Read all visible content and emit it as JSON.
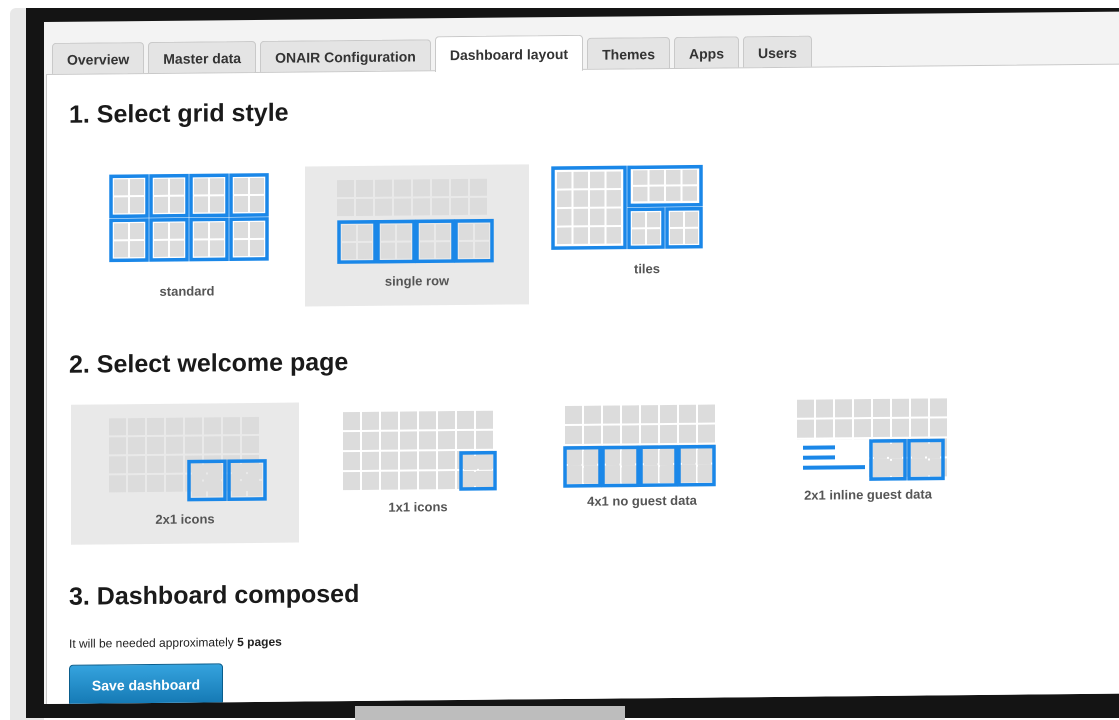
{
  "tabs": [
    {
      "label": "Overview",
      "active": false
    },
    {
      "label": "Master data",
      "active": false
    },
    {
      "label": "ONAIR Configuration",
      "active": false
    },
    {
      "label": "Dashboard layout",
      "active": true
    },
    {
      "label": "Themes",
      "active": false
    },
    {
      "label": "Apps",
      "active": false
    },
    {
      "label": "Users",
      "active": false
    }
  ],
  "section1": {
    "title": "1. Select grid style",
    "options": [
      {
        "label": "standard",
        "selected": false
      },
      {
        "label": "single row",
        "selected": true
      },
      {
        "label": "tiles",
        "selected": false
      }
    ]
  },
  "section2": {
    "title": "2. Select welcome page",
    "options": [
      {
        "label": "2x1 icons",
        "selected": true
      },
      {
        "label": "1x1 icons",
        "selected": false
      },
      {
        "label": "4x1 no guest data",
        "selected": false
      },
      {
        "label": "2x1 inline guest data",
        "selected": false
      }
    ]
  },
  "section3": {
    "title": "3. Dashboard composed",
    "note_prefix": "It will be needed approximately",
    "note_value": "5 pages",
    "save_label": "Save dashboard"
  },
  "colors": {
    "accent": "#1a87e8",
    "grid_gray": "#dcdcdc",
    "selected_bg": "#e9e9e9",
    "button": "#1c8bcb"
  }
}
